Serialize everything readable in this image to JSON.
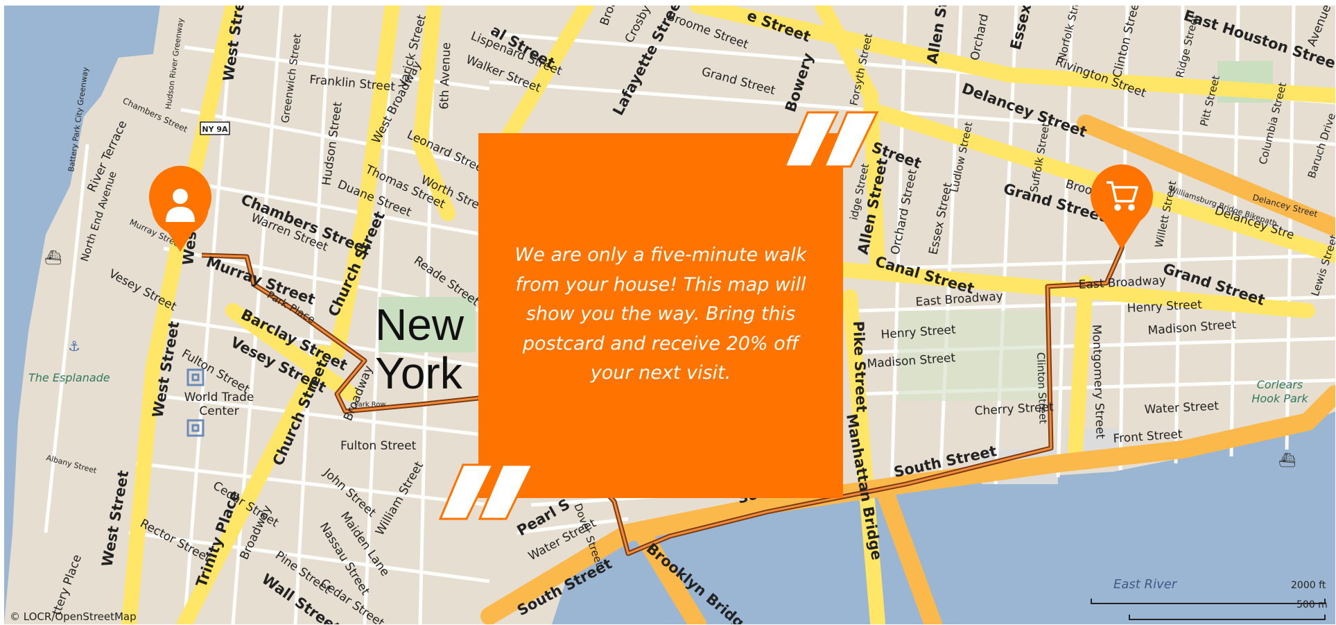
{
  "postcard": {
    "message": "We are only a five-minute walk from your house! This map will show you the way. Bring this postcard and receive 20% off your next visit."
  },
  "colors": {
    "accent": "#ff7300",
    "route": "#7a3a12",
    "water": "#9bb6d2",
    "land": "#e6ded0",
    "major_road": "#ffe666",
    "highway": "#fcb94b",
    "park": "#c9dfc0"
  },
  "markers": {
    "start_icon": "person-icon",
    "end_icon": "shopping-cart-icon"
  },
  "map": {
    "city_label_line1": "New",
    "city_label_line2": "York",
    "shield": "NY 9A",
    "landmarks": {
      "wtc_line1": "World Trade",
      "wtc_line2": "Center",
      "esplanade": "The Esplanade",
      "corlears_line1": "Corlears",
      "corlears_line2": "Hook Park",
      "east_river": "East River"
    },
    "streets": {
      "west_street": "West Street",
      "west_st_short": "West",
      "franklin": "Franklin Street",
      "greenwich": "Greenwich Street",
      "varick": "Varick Street",
      "sixth_ave": "6th Avenue",
      "lispenard": "Lispenard Street",
      "walker": "Walker Street",
      "broadway_top": "Broad",
      "crosby": "Crosby Stre",
      "lafayette": "Lafayette Street",
      "canal_top": "al Street",
      "broome": "Broome Street",
      "street_top": "e Street",
      "grand_top": "Grand Street",
      "bowery": "Bowery",
      "forsyth": "Forsyth Street",
      "allen_top": "Allen Str",
      "orchard_top": "Orchard",
      "essex_top": "Essex Str",
      "norfolk": "Norfolk Street",
      "rivington": "Rivington Street",
      "clinton_top": "Clinton Street",
      "ridge": "Ridge Street",
      "east_houston": "East Houston Street",
      "avenue": "Avenue",
      "delancey": "Delancey Street",
      "pitt": "Pitt Street",
      "columbia": "Columbia Street",
      "baruch": "Baruch Drive",
      "suffolk": "Suffolk Street",
      "williamsburg": "Williamsburg Bridge Bikepath",
      "delancey_small": "Delancey Street",
      "delancey_right": "Delancey Stre",
      "willett": "Willett Street",
      "hudson_river": "Hudson River Greenway",
      "chambers": "Chambers Street",
      "chambers_left": "Chambers Street",
      "warren": "Warren Street",
      "murray": "Murray Street",
      "hudson": "Hudson Street",
      "duane": "Duane Street",
      "west_broadway": "West Broadway",
      "leonard": "Leonard Street",
      "thomas": "Thomas Street",
      "worth": "Worth Street",
      "reade": "Reade Street",
      "church": "Church Street",
      "park_place": "Park Place",
      "barclay": "Barclay Street",
      "vesey": "Vesey Street",
      "vesey_left": "Vesey Street",
      "river_terrace": "River Terrace",
      "north_end": "North End Avenue",
      "murray_left": "Murray Street",
      "battery_park": "Battery Park City Greenway",
      "fulton_left": "Fulton Street",
      "fulton": "Fulton Street",
      "broadway": "Broadway",
      "park_row": "Park Row",
      "church_lower": "Church Street",
      "john": "John Street",
      "maiden": "Maiden Lane",
      "nassau": "Nassau Street",
      "cedar": "Cedar Street",
      "cedar_lower": "Cedar Street",
      "pine": "Pine Street",
      "wall": "Wall Street",
      "william": "William Street",
      "rector": "Rector Street",
      "trinity": "Trinity Place",
      "broadway_lower": "Broadway",
      "albany": "Albany Street",
      "west_street_lower": "West Street",
      "battery_place": "ttery Place",
      "pearl": "Pearl S",
      "water": "Water Street",
      "dover": "Dover Street",
      "south_street": "South Street",
      "south_street_mid": "South Street",
      "south_short": "Sou",
      "brooklyn_bridge": "Brooklyn Bridge",
      "manhattan_bridge": "Manhattan Bridge",
      "pike": "Pike Street",
      "allen": "Allen Street",
      "orchard": "Orchard Street",
      "essex": "Essex Street",
      "canal": "Canal Street",
      "ludlow": "Ludlow Street",
      "street_right": "Street",
      "bridge_st": "idge Street",
      "east_broadway": "East Broadway",
      "east_broadway_right": "East Broadway",
      "henry": "Henry Street",
      "henry_right": "Henry Street",
      "madison": "Madison Street",
      "madison_right": "Madison Street",
      "cherry": "Cherry Street",
      "water_right": "Water Street",
      "front": "Front Street",
      "montgomery": "Montgomery Street",
      "clinton": "Clinton Street",
      "grand": "Grand Street",
      "grand_right": "Grand Street",
      "lewis": "Lewis Street",
      "broo": "Broo"
    }
  },
  "scale": {
    "feet": "2000 ft",
    "meters": "500 m"
  },
  "attribution": "© LOCR/OpenStreetMap"
}
